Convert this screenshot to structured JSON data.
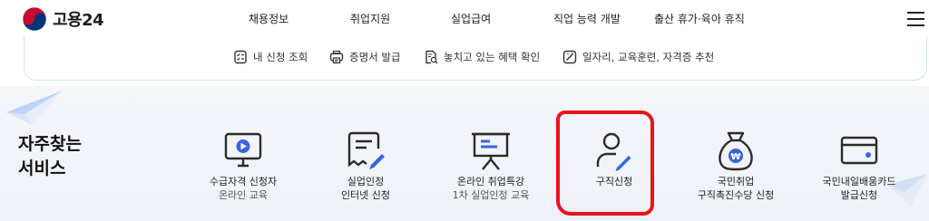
{
  "header": {
    "logo_text": "고용24",
    "nav": [
      {
        "label": "채용정보"
      },
      {
        "label": "취업지원"
      },
      {
        "label": "실업급여"
      },
      {
        "label": "직업 능력 개발"
      },
      {
        "label": "출산 휴가·육아 휴직"
      }
    ]
  },
  "quick_links": [
    {
      "label": "내 신청 조회",
      "icon": "checklist-icon"
    },
    {
      "label": "증명서 발급",
      "icon": "printer-icon"
    },
    {
      "label": "놓치고 있는 혜택 확인",
      "icon": "document-search-icon"
    },
    {
      "label": "일자리, 교육훈련, 자격증 추천",
      "icon": "magic-wand-icon"
    }
  ],
  "services_section": {
    "title_line1": "자주찾는",
    "title_line2": "서비스",
    "items": [
      {
        "line1": "수급자격 신청자",
        "line2": "온라인 교육",
        "icon": "video-monitor-icon"
      },
      {
        "line1": "실업인정",
        "line2": "인터넷 신청",
        "icon": "form-pen-icon"
      },
      {
        "line1": "온라인 취업특강",
        "line2": "1차 실업인정 교육",
        "icon": "presentation-board-icon"
      },
      {
        "line1": "구직신청",
        "line2": "",
        "icon": "person-pen-icon"
      },
      {
        "line1": "국민취업",
        "line2": "구직촉진수당 신청",
        "icon": "money-bag-icon"
      },
      {
        "line1": "국민내일배움카드",
        "line2": "발급신청",
        "icon": "credit-card-icon"
      }
    ]
  },
  "colors": {
    "accent_blue": "#3d63dd",
    "highlight_red": "#e8141c",
    "icon_stroke": "#2b2b2b"
  }
}
